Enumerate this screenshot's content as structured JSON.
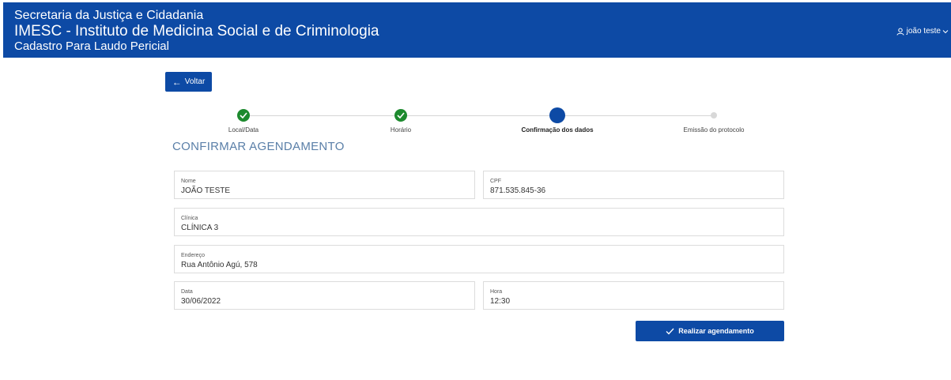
{
  "header": {
    "line1": "Secretaria da Justiça e Cidadania",
    "line2": "IMESC - Instituto de Medicina Social e de Criminologia",
    "line3": "Cadastro Para Laudo Pericial",
    "user_name": "joão teste",
    "background_color": "#0d4aa5"
  },
  "back_button": {
    "label": "Voltar",
    "icon": "arrow-left-icon"
  },
  "stepper": {
    "steps": [
      {
        "label": "Local/Data",
        "status": "done"
      },
      {
        "label": "Horário",
        "status": "done"
      },
      {
        "label": "Confirmação dos dados",
        "status": "current"
      },
      {
        "label": "Emissão do protocolo",
        "status": "pending"
      }
    ],
    "done_color": "#1d8a2e",
    "current_color": "#0d4aa5"
  },
  "section_title": "CONFIRMAR AGENDAMENTO",
  "fields": {
    "nome": {
      "label": "Nome",
      "value": "JOÃO TESTE"
    },
    "cpf": {
      "label": "CPF",
      "value": "871.535.845-36"
    },
    "clinica": {
      "label": "Clínica",
      "value": "CLÍNICA 3"
    },
    "endereco": {
      "label": "Endereço",
      "value": "Rua Antônio Agú, 578"
    },
    "data": {
      "label": "Data",
      "value": "30/06/2022"
    },
    "hora": {
      "label": "Hora",
      "value": "12:30"
    }
  },
  "submit_button": {
    "label": "Realizar agendamento",
    "icon": "check-icon"
  }
}
